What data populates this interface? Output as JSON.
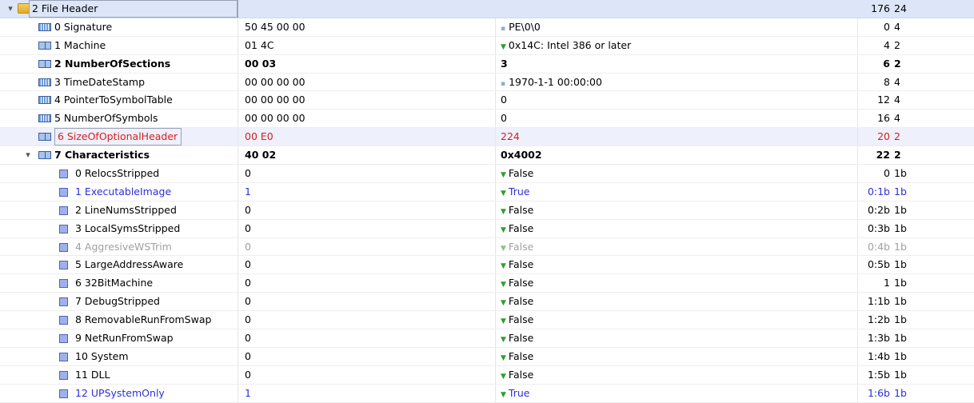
{
  "rows": [
    {
      "name": "2 File Header",
      "hex": "",
      "value": "",
      "glyph": "",
      "offset": "176",
      "size": "24",
      "level": 0,
      "icon": "folder-icon",
      "toggle": "expanded",
      "style": "header"
    },
    {
      "name": "0 Signature",
      "hex": "50 45 00 00",
      "value": "PE\\0\\0",
      "glyph": "dot",
      "offset": "0",
      "size": "4",
      "level": 1,
      "icon": "array-icon",
      "toggle": "",
      "style": ""
    },
    {
      "name": "1 Machine",
      "hex": "01 4C",
      "value": "0x14C: Intel 386 or later",
      "glyph": "tri",
      "offset": "4",
      "size": "2",
      "level": 1,
      "icon": "struct-icon",
      "toggle": "",
      "style": ""
    },
    {
      "name": "2 NumberOfSections",
      "hex": "00 03",
      "value": "3",
      "glyph": "",
      "offset": "6",
      "size": "2",
      "level": 1,
      "icon": "struct-icon",
      "toggle": "",
      "style": "bold"
    },
    {
      "name": "3 TimeDateStamp",
      "hex": "00 00 00 00",
      "value": "1970-1-1 00:00:00",
      "glyph": "dot",
      "offset": "8",
      "size": "4",
      "level": 1,
      "icon": "array-icon",
      "toggle": "",
      "style": ""
    },
    {
      "name": "4 PointerToSymbolTable",
      "hex": "00 00 00 00",
      "value": "0",
      "glyph": "",
      "offset": "12",
      "size": "4",
      "level": 1,
      "icon": "array-icon",
      "toggle": "",
      "style": ""
    },
    {
      "name": "5 NumberOfSymbols",
      "hex": "00 00 00 00",
      "value": "0",
      "glyph": "",
      "offset": "16",
      "size": "4",
      "level": 1,
      "icon": "array-icon",
      "toggle": "",
      "style": ""
    },
    {
      "name": "6 SizeOfOptionalHeader",
      "hex": "00 E0",
      "value": "224",
      "glyph": "",
      "offset": "20",
      "size": "2",
      "level": 1,
      "icon": "struct-icon",
      "toggle": "",
      "style": "red selected"
    },
    {
      "name": "7 Characteristics",
      "hex": "40 02",
      "value": "0x4002",
      "glyph": "",
      "offset": "22",
      "size": "2",
      "level": 1,
      "icon": "struct-icon",
      "toggle": "expanded",
      "style": "bold"
    },
    {
      "name": "0 RelocsStripped",
      "hex": "0",
      "value": "False",
      "glyph": "tri",
      "offset": "0",
      "size": "1b",
      "level": 2,
      "icon": "bit-icon",
      "toggle": "",
      "style": ""
    },
    {
      "name": "1 ExecutableImage",
      "hex": "1",
      "value": "True",
      "glyph": "tri",
      "offset": "0:1b",
      "size": "1b",
      "level": 2,
      "icon": "bit-icon",
      "toggle": "",
      "style": "blue"
    },
    {
      "name": "2 LineNumsStripped",
      "hex": "0",
      "value": "False",
      "glyph": "tri",
      "offset": "0:2b",
      "size": "1b",
      "level": 2,
      "icon": "bit-icon",
      "toggle": "",
      "style": ""
    },
    {
      "name": "3 LocalSymsStripped",
      "hex": "0",
      "value": "False",
      "glyph": "tri",
      "offset": "0:3b",
      "size": "1b",
      "level": 2,
      "icon": "bit-icon",
      "toggle": "",
      "style": ""
    },
    {
      "name": "4 AggresiveWSTrim",
      "hex": "0",
      "value": "False",
      "glyph": "tri",
      "offset": "0:4b",
      "size": "1b",
      "level": 2,
      "icon": "bit-icon",
      "toggle": "",
      "style": "gray"
    },
    {
      "name": "5 LargeAddressAware",
      "hex": "0",
      "value": "False",
      "glyph": "tri",
      "offset": "0:5b",
      "size": "1b",
      "level": 2,
      "icon": "bit-icon",
      "toggle": "",
      "style": ""
    },
    {
      "name": "6 32BitMachine",
      "hex": "0",
      "value": "False",
      "glyph": "tri",
      "offset": "1",
      "size": "1b",
      "level": 2,
      "icon": "bit-icon",
      "toggle": "",
      "style": ""
    },
    {
      "name": "7 DebugStripped",
      "hex": "0",
      "value": "False",
      "glyph": "tri",
      "offset": "1:1b",
      "size": "1b",
      "level": 2,
      "icon": "bit-icon",
      "toggle": "",
      "style": ""
    },
    {
      "name": "8 RemovableRunFromSwap",
      "hex": "0",
      "value": "False",
      "glyph": "tri",
      "offset": "1:2b",
      "size": "1b",
      "level": 2,
      "icon": "bit-icon",
      "toggle": "",
      "style": ""
    },
    {
      "name": "9 NetRunFromSwap",
      "hex": "0",
      "value": "False",
      "glyph": "tri",
      "offset": "1:3b",
      "size": "1b",
      "level": 2,
      "icon": "bit-icon",
      "toggle": "",
      "style": ""
    },
    {
      "name": "10 System",
      "hex": "0",
      "value": "False",
      "glyph": "tri",
      "offset": "1:4b",
      "size": "1b",
      "level": 2,
      "icon": "bit-icon",
      "toggle": "",
      "style": ""
    },
    {
      "name": "11 DLL",
      "hex": "0",
      "value": "False",
      "glyph": "tri",
      "offset": "1:5b",
      "size": "1b",
      "level": 2,
      "icon": "bit-icon",
      "toggle": "",
      "style": ""
    },
    {
      "name": "12 UPSystemOnly",
      "hex": "1",
      "value": "True",
      "glyph": "tri",
      "offset": "1:6b",
      "size": "1b",
      "level": 2,
      "icon": "bit-icon",
      "toggle": "",
      "style": "blue"
    }
  ],
  "colors": {
    "header_bg": "#dde6f8",
    "selected_bg": "#eef0fc",
    "highlight_blue": "#2e2ed8",
    "highlight_red": "#d6201c",
    "disabled_gray": "#a0a0a0",
    "enum_triangle_green": "#2f9e2f"
  },
  "glyphs": {
    "tri": "▼",
    "dot": "▪",
    "expanded": "▾"
  }
}
